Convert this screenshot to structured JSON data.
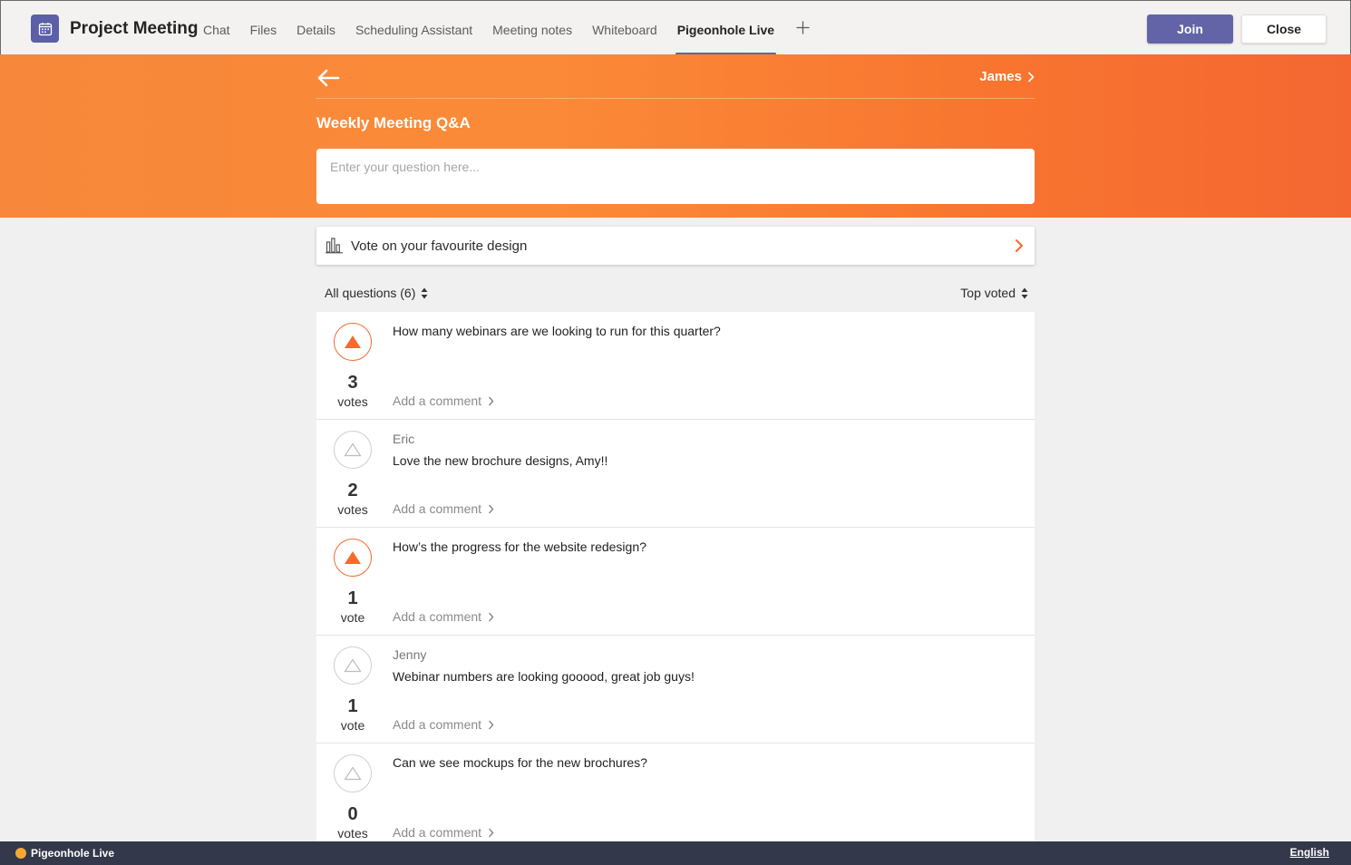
{
  "window": {
    "title": "Project Meeting",
    "tabs": [
      {
        "label": "Chat"
      },
      {
        "label": "Files"
      },
      {
        "label": "Details"
      },
      {
        "label": "Scheduling Assistant"
      },
      {
        "label": "Meeting notes"
      },
      {
        "label": "Whiteboard"
      },
      {
        "label": "Pigeonhole Live",
        "active": true
      }
    ],
    "add_tab_icon": "plus-icon",
    "join_label": "Join",
    "close_label": "Close",
    "accent_color": "#6264a7"
  },
  "header": {
    "back_icon": "arrow-left-icon",
    "user_name": "James",
    "event_title": "Weekly Meeting Q&A",
    "question_placeholder": "Enter your question here...",
    "gradient_colors": [
      "#f7873a",
      "#f46731"
    ]
  },
  "poll": {
    "icon": "bar-chart-icon",
    "label": "Vote on your favourite design"
  },
  "filters": {
    "all_questions_label": "All questions (6)",
    "sort_label": "Top voted"
  },
  "questions": [
    {
      "author": "",
      "text": "How many webinars are we looking to run for this quarter?",
      "votes": "3",
      "unit": "votes",
      "voted": true,
      "comment_label": "Add a comment"
    },
    {
      "author": "Eric",
      "text": "Love the new brochure designs, Amy!!",
      "votes": "2",
      "unit": "votes",
      "voted": false,
      "comment_label": "Add a comment"
    },
    {
      "author": "",
      "text": "How’s the progress for the website redesign?",
      "votes": "1",
      "unit": "vote",
      "voted": true,
      "comment_label": "Add a comment"
    },
    {
      "author": "Jenny",
      "text": "Webinar numbers are looking gooood, great job guys!",
      "votes": "1",
      "unit": "vote",
      "voted": false,
      "comment_label": "Add a comment"
    },
    {
      "author": "",
      "text": "Can we see mockups for the new brochures?",
      "votes": "0",
      "unit": "votes",
      "voted": false,
      "comment_label": "Add a comment"
    }
  ],
  "footer": {
    "brand": "Pigeonhole Live",
    "language": "English"
  }
}
